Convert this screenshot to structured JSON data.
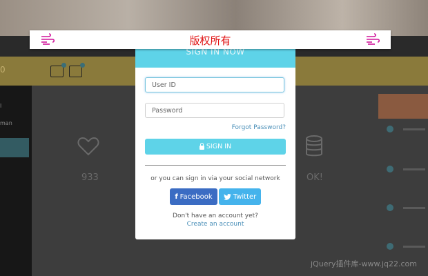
{
  "banner": {
    "title": "版权所有"
  },
  "modal": {
    "header": "SIGN IN NOW",
    "user_id_placeholder": "User ID",
    "password_placeholder": "Password",
    "forgot_password": "Forgot Password?",
    "sign_in_label": "SIGN IN",
    "social_text": "or you can sign in via your social network",
    "facebook_label": "Facebook",
    "twitter_label": "Twitter",
    "no_account": "Don't have an account yet?",
    "create_account": "Create an account"
  },
  "background": {
    "sidebar_items": [
      "man"
    ],
    "stats": [
      "933",
      "OK!"
    ],
    "watermark": "jQuery插件库-www.jq22.com"
  },
  "colors": {
    "accent": "#5ed3e8",
    "facebook": "#3b6cc3",
    "twitter": "#45b3ec",
    "banner_text": "#e01010",
    "link": "#4a8fb8"
  },
  "icons": [
    "wind-icon",
    "lock-icon",
    "facebook-icon",
    "twitter-icon",
    "heart-icon",
    "database-icon"
  ]
}
